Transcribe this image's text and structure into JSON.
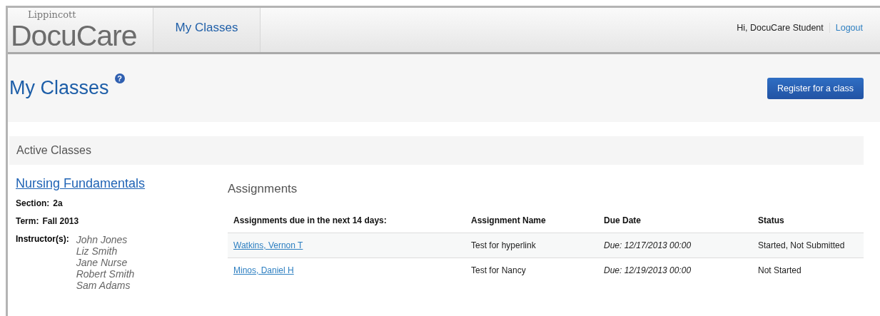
{
  "header": {
    "logo": {
      "top": "Lippincott",
      "main": "DocuCare"
    },
    "nav": [
      {
        "label": "My Classes",
        "selected": true
      }
    ],
    "greeting": "Hi, DocuCare Student",
    "logout": "Logout"
  },
  "page": {
    "title": "My Classes",
    "help": "?",
    "button": "Register for a class"
  },
  "section": {
    "title": "Active Classes"
  },
  "class": {
    "name": "Nursing Fundamentals",
    "section_label": "Section:",
    "section": "2a",
    "term_label": "Term:",
    "term": "Fall 2013",
    "instructors_label": "Instructor(s):",
    "instructors": [
      "John Jones",
      "Liz Smith",
      "Jane Nurse",
      "Robert Smith",
      "Sam Adams"
    ]
  },
  "assignments": {
    "title": "Assignments",
    "columns": [
      "Assignments due in the next 14 days:",
      "Assignment Name",
      "Due Date",
      "Status"
    ],
    "rows": [
      {
        "student": "Watkins, Vernon T",
        "name": "Test for hyperlink",
        "due": "Due: 12/17/2013 00:00",
        "status": "Started, Not Submitted"
      },
      {
        "student": "Minos, Daniel H",
        "name": "Test for Nancy",
        "due": "Due: 12/19/2013 00:00",
        "status": "Not Started"
      }
    ]
  }
}
